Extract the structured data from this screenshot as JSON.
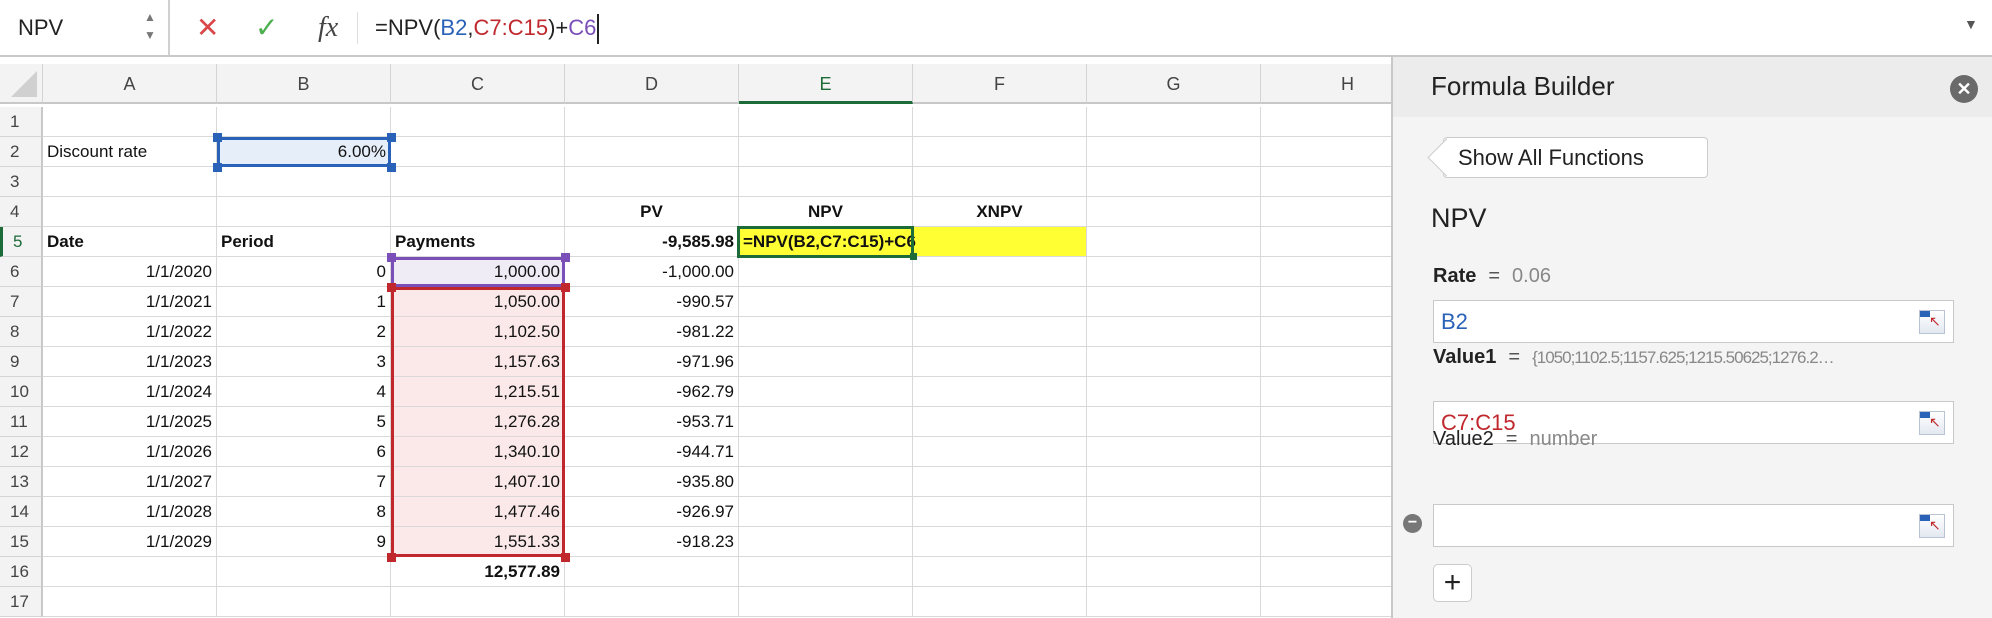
{
  "formula_bar": {
    "name_box": "NPV",
    "cancel_icon": "✕",
    "enter_icon": "✓",
    "fx_label": "fx",
    "formula_parts": [
      {
        "text": "=NPV(",
        "color": "#222222"
      },
      {
        "text": "B2",
        "color": "#2a62b8"
      },
      {
        "text": ",",
        "color": "#222222"
      },
      {
        "text": "C7:C15",
        "color": "#c0282d"
      },
      {
        "text": ")+",
        "color": "#222222"
      },
      {
        "text": "C6",
        "color": "#7a4fb8"
      }
    ]
  },
  "sheet": {
    "columns": [
      "A",
      "B",
      "C",
      "D",
      "E",
      "F",
      "G",
      "H"
    ],
    "active_column": "E",
    "active_row": 5,
    "rows": [
      {
        "n": "1",
        "cells": {}
      },
      {
        "n": "2",
        "cells": {
          "A": "Discount rate",
          "B": "6.00%"
        }
      },
      {
        "n": "3",
        "cells": {}
      },
      {
        "n": "4",
        "cells": {
          "D": "PV",
          "E": "NPV",
          "F": "XNPV"
        }
      },
      {
        "n": "5",
        "cells": {
          "A": "Date",
          "B": "Period",
          "C": "Payments",
          "D": "-9,585.98",
          "E": "=NPV(B2,C7:C15)+C6"
        }
      },
      {
        "n": "6",
        "cells": {
          "A": "1/1/2020",
          "B": "0",
          "C": "1,000.00",
          "D": "-1,000.00"
        }
      },
      {
        "n": "7",
        "cells": {
          "A": "1/1/2021",
          "B": "1",
          "C": "1,050.00",
          "D": "-990.57"
        }
      },
      {
        "n": "8",
        "cells": {
          "A": "1/1/2022",
          "B": "2",
          "C": "1,102.50",
          "D": "-981.22"
        }
      },
      {
        "n": "9",
        "cells": {
          "A": "1/1/2023",
          "B": "3",
          "C": "1,157.63",
          "D": "-971.96"
        }
      },
      {
        "n": "10",
        "cells": {
          "A": "1/1/2024",
          "B": "4",
          "C": "1,215.51",
          "D": "-962.79"
        }
      },
      {
        "n": "11",
        "cells": {
          "A": "1/1/2025",
          "B": "5",
          "C": "1,276.28",
          "D": "-953.71"
        }
      },
      {
        "n": "12",
        "cells": {
          "A": "1/1/2026",
          "B": "6",
          "C": "1,340.10",
          "D": "-944.71"
        }
      },
      {
        "n": "13",
        "cells": {
          "A": "1/1/2027",
          "B": "7",
          "C": "1,407.10",
          "D": "-935.80"
        }
      },
      {
        "n": "14",
        "cells": {
          "A": "1/1/2028",
          "B": "8",
          "C": "1,477.46",
          "D": "-926.97"
        }
      },
      {
        "n": "15",
        "cells": {
          "A": "1/1/2029",
          "B": "9",
          "C": "1,551.33",
          "D": "-918.23"
        }
      },
      {
        "n": "16",
        "cells": {
          "C": "12,577.89"
        }
      },
      {
        "n": "17",
        "cells": {}
      }
    ],
    "colors": {
      "rate_ref": "#2a62b8",
      "value_ref": "#c0282d",
      "c6_ref": "#7a4fb8",
      "active": "#1e6b3a",
      "highlight": "#ffff33"
    }
  },
  "formula_builder": {
    "title": "Formula Builder",
    "close_icon": "✕",
    "show_all_label": "Show All Functions",
    "function_name": "NPV",
    "args": [
      {
        "label": "Rate",
        "eq": "=",
        "value": "0.06",
        "input": "B2",
        "input_color": "#2a62b8",
        "bold": true
      },
      {
        "label": "Value1",
        "eq": "=",
        "value": "{1050;1102.5;1157.625;1215.50625;1276.2…",
        "input": "C7:C15",
        "input_color": "#c0282d",
        "bold": true
      },
      {
        "label": "Value2",
        "eq": "=",
        "value": "number",
        "input": "",
        "input_color": "#222222",
        "bold": false
      }
    ],
    "remove_icon": "−",
    "add_icon": "+"
  }
}
